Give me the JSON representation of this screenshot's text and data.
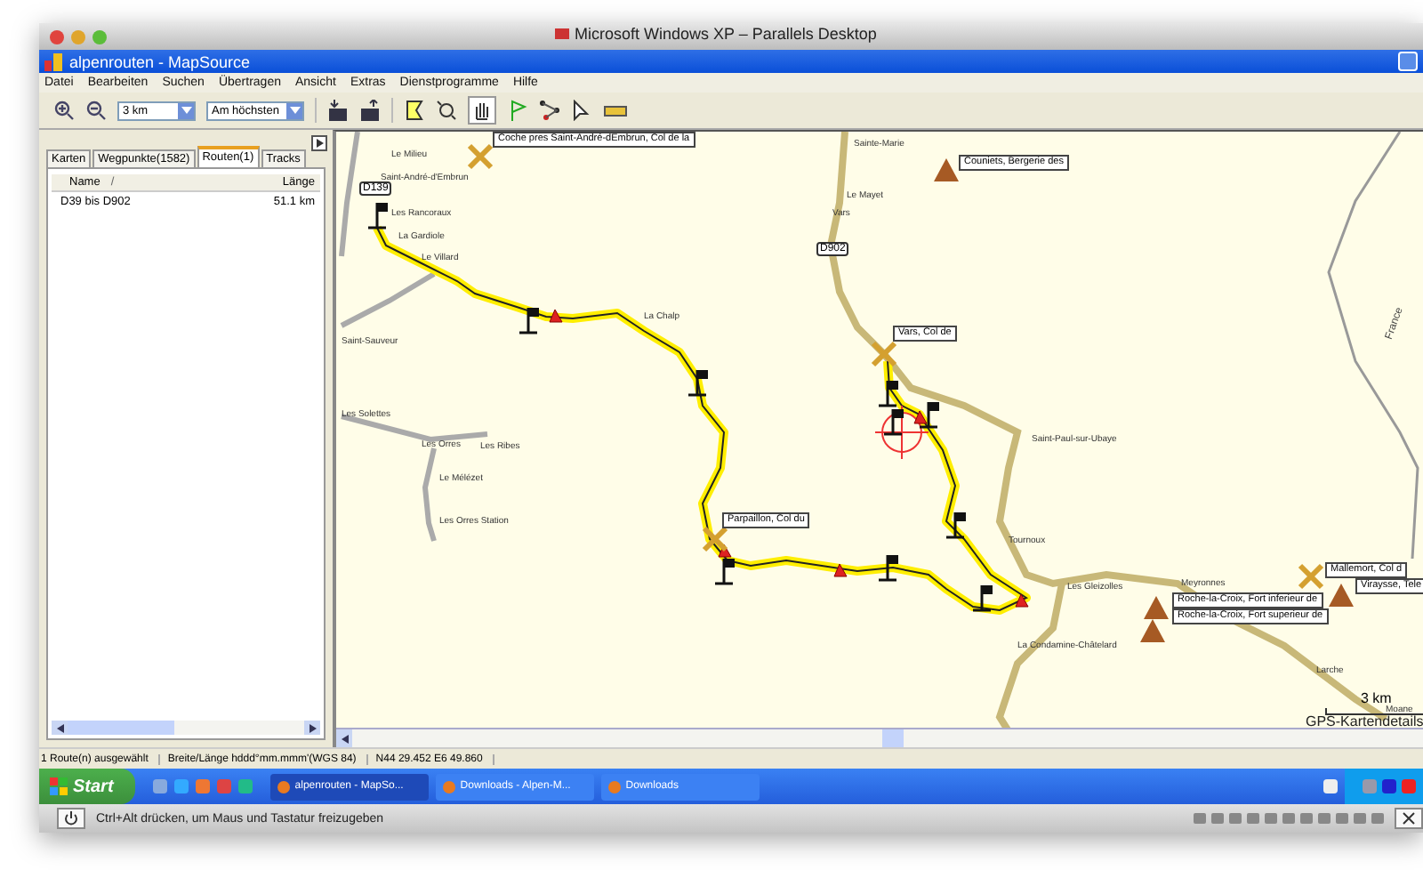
{
  "mac_window": {
    "title": "Microsoft Windows XP – Parallels Desktop"
  },
  "app": {
    "title": "alpenrouten - MapSource"
  },
  "menu": [
    "Datei",
    "Bearbeiten",
    "Suchen",
    "Übertragen",
    "Ansicht",
    "Extras",
    "Dienstprogramme",
    "Hilfe"
  ],
  "toolbar": {
    "scale": "3 km",
    "detail": "Am höchsten"
  },
  "sidebar": {
    "tabs": [
      {
        "label": "Karten",
        "selected": false
      },
      {
        "label": "Wegpunkte(1582)",
        "selected": false
      },
      {
        "label": "Routen(1)",
        "selected": true
      },
      {
        "label": "Tracks",
        "selected": false
      }
    ],
    "columns": [
      {
        "label": "Name",
        "sort": "/"
      },
      {
        "label": "Länge"
      }
    ],
    "rows": [
      {
        "name": "D39 bis D902",
        "length": "51.1 km"
      }
    ]
  },
  "map": {
    "places": [
      "Le Milieu",
      "Saint-André-d'Embrun",
      "Les Rancoraux",
      "La Gardiole",
      "Le Villard",
      "La Chalp",
      "Saint-Sauveur",
      "Les Solettes",
      "Les Orres",
      "Les Ribes",
      "Le Mélézet",
      "Les Orres Station",
      "Sainte-Marie",
      "Le Mayet",
      "Vars",
      "Saint-Paul-sur-Ubaye",
      "Tournoux",
      "Les Gleizolles",
      "Meyronnes",
      "La Condamine-Châtelard",
      "Larche",
      "Moane"
    ],
    "roads": [
      "D139",
      "D902"
    ],
    "waypoints": [
      {
        "label": "Coche pres Saint-André-dEmbrun, Col de la",
        "kind": "pass"
      },
      {
        "label": "Couniets, Bergerie des",
        "kind": "peak"
      },
      {
        "label": "Vars, Col de",
        "kind": "pass"
      },
      {
        "label": "Parpaillon, Col du",
        "kind": "pass"
      },
      {
        "label": "Mallemort, Col d",
        "kind": "pass"
      },
      {
        "label": "Viraysse, Tele",
        "kind": "peak"
      },
      {
        "label": "Roche-la-Croix, Fort inferieur de",
        "kind": "peak"
      },
      {
        "label": "Roche-la-Croix, Fort superieur de",
        "kind": "peak"
      }
    ],
    "region": "France",
    "scale": "3 km",
    "detail_label": "GPS-Kartendetails"
  },
  "status_bar": [
    "1 Route(n) ausgewählt",
    "Breite/Länge hddd°mm.mmm'(WGS 84)",
    "N44 29.452 E6 49.860"
  ],
  "taskbar": {
    "start": "Start",
    "tasks": [
      {
        "label": "alpenrouten - MapSo...",
        "selected": true
      },
      {
        "label": "Downloads - Alpen-M...",
        "selected": false
      },
      {
        "label": "Downloads",
        "selected": false
      }
    ]
  },
  "vm_bar": {
    "hint": "Ctrl+Alt drücken, um Maus und Tastatur freizugeben"
  }
}
